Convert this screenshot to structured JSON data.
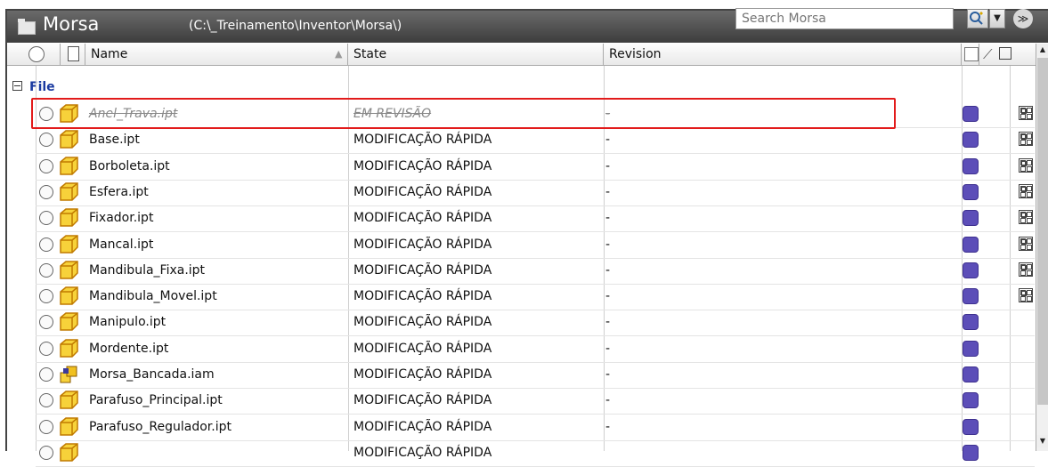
{
  "window": {
    "title": "Morsa",
    "path": "(C:\\_Treinamento\\Inventor\\Morsa\\)",
    "search_placeholder": "Search Morsa"
  },
  "columns": {
    "name": "Name",
    "state": "State",
    "revision": "Revision"
  },
  "group": {
    "label": "File"
  },
  "status_color": "#5c4eb8",
  "highlight_color": "#e21b1b",
  "rows": [
    {
      "name": "Anel_Trava.ipt",
      "state": "EM REVISÃO",
      "revision": "-",
      "icon": "part-icon",
      "struck": true,
      "grid": true
    },
    {
      "name": "Base.ipt",
      "state": "MODIFICAÇÃO RÁPIDA",
      "revision": "-",
      "icon": "part-icon",
      "grid": true
    },
    {
      "name": "Borboleta.ipt",
      "state": "MODIFICAÇÃO RÁPIDA",
      "revision": "-",
      "icon": "part-icon",
      "grid": true
    },
    {
      "name": "Esfera.ipt",
      "state": "MODIFICAÇÃO RÁPIDA",
      "revision": "-",
      "icon": "part-icon",
      "grid": true
    },
    {
      "name": "Fixador.ipt",
      "state": "MODIFICAÇÃO RÁPIDA",
      "revision": "-",
      "icon": "part-icon",
      "grid": true
    },
    {
      "name": "Mancal.ipt",
      "state": "MODIFICAÇÃO RÁPIDA",
      "revision": "-",
      "icon": "part-icon",
      "grid": true
    },
    {
      "name": "Mandibula_Fixa.ipt",
      "state": "MODIFICAÇÃO RÁPIDA",
      "revision": "-",
      "icon": "part-icon",
      "grid": true
    },
    {
      "name": "Mandibula_Movel.ipt",
      "state": "MODIFICAÇÃO RÁPIDA",
      "revision": "-",
      "icon": "part-icon",
      "grid": true
    },
    {
      "name": "Manipulo.ipt",
      "state": "MODIFICAÇÃO RÁPIDA",
      "revision": "-",
      "icon": "part-icon",
      "grid": false
    },
    {
      "name": "Mordente.ipt",
      "state": "MODIFICAÇÃO RÁPIDA",
      "revision": "-",
      "icon": "part-icon",
      "grid": false
    },
    {
      "name": "Morsa_Bancada.iam",
      "state": "MODIFICAÇÃO RÁPIDA",
      "revision": "-",
      "icon": "assembly-icon",
      "grid": false
    },
    {
      "name": "Parafuso_Principal.ipt",
      "state": "MODIFICAÇÃO RÁPIDA",
      "revision": "-",
      "icon": "part-icon",
      "grid": false
    },
    {
      "name": "Parafuso_Regulador.ipt",
      "state": "MODIFICAÇÃO RÁPIDA",
      "revision": "-",
      "icon": "part-icon",
      "grid": false
    },
    {
      "name": "",
      "state": "MODIFICAÇÃO RÁPIDA",
      "revision": "",
      "icon": "part-icon",
      "grid": false
    }
  ]
}
